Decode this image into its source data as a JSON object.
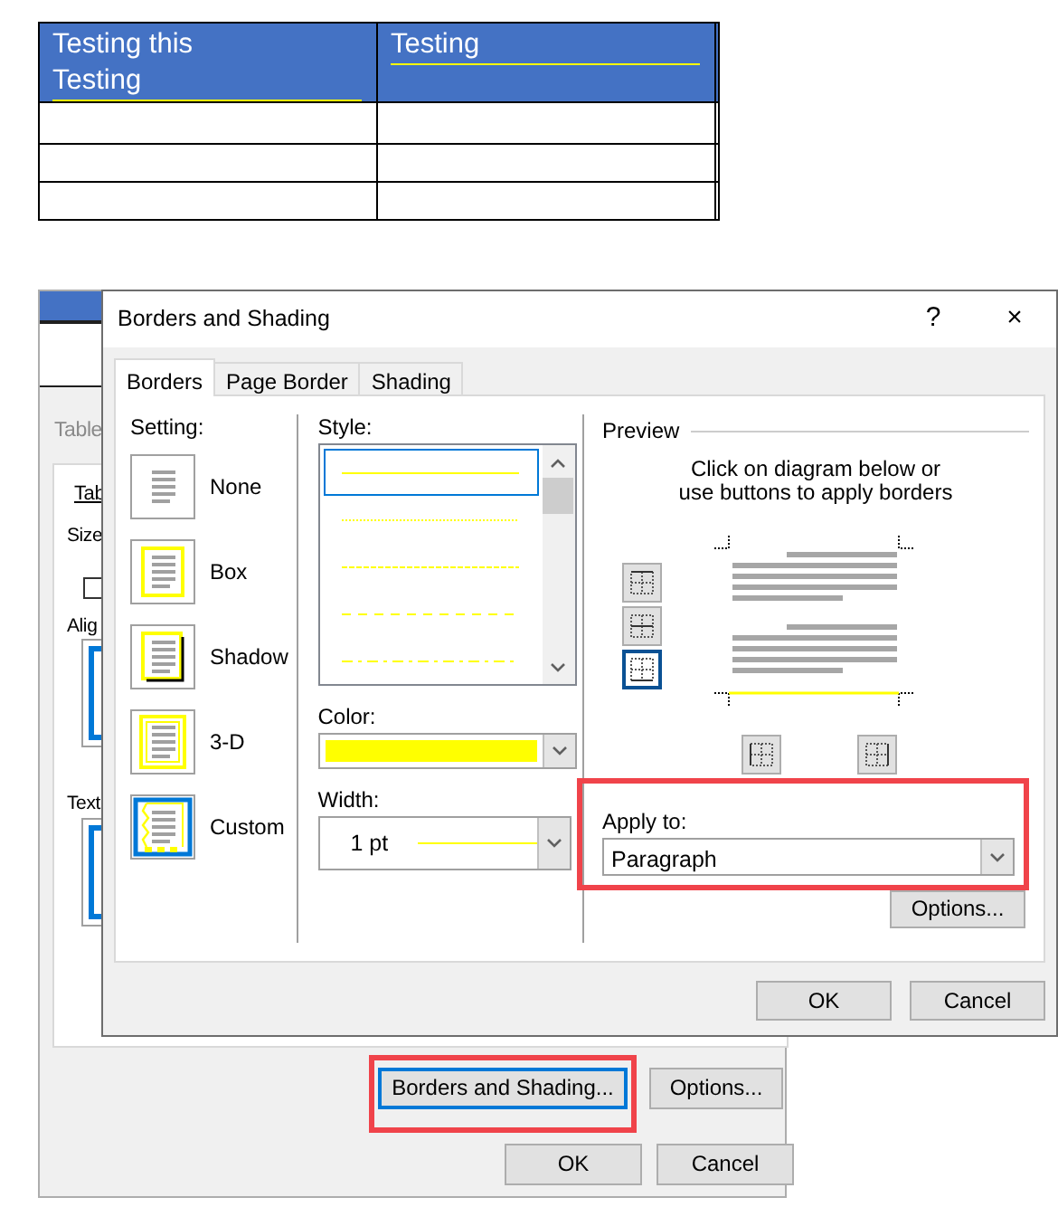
{
  "document_table": {
    "header_cells": [
      {
        "lines": [
          "Testing this",
          "Testing"
        ],
        "bottom_border": true
      },
      {
        "lines": [
          "Testing"
        ],
        "bottom_border": true
      }
    ]
  },
  "table_properties": {
    "caption": "Table",
    "tab": "Tab",
    "labels": [
      "Size",
      "Alig",
      "Text"
    ],
    "checkbox": {
      "checked": false
    },
    "buttons": [
      {
        "label": "Borders and Shading...",
        "focused": true,
        "highlighted": true
      },
      {
        "label": "Options...",
        "focused": false,
        "highlighted": false
      }
    ],
    "footer_buttons": [
      "OK",
      "Cancel"
    ]
  },
  "dialog": {
    "title": "Borders and Shading",
    "help": "?",
    "close": "×",
    "tabs": [
      {
        "label": "Borders",
        "selected": true
      },
      {
        "label": "Page Border",
        "selected": false
      },
      {
        "label": "Shading",
        "selected": false
      }
    ],
    "setting": {
      "label": "Setting:",
      "options": [
        {
          "kind": "none",
          "label": "None",
          "selected": false
        },
        {
          "kind": "box",
          "label": "Box",
          "selected": false
        },
        {
          "kind": "shadow",
          "label": "Shadow",
          "selected": false
        },
        {
          "kind": "threed",
          "label": "3-D",
          "selected": false
        },
        {
          "kind": "custom",
          "label": "Custom",
          "selected": true
        }
      ]
    },
    "style": {
      "label": "Style:",
      "lines": [
        {
          "kind": "solid",
          "selected": true
        },
        {
          "kind": "dotted",
          "selected": false
        },
        {
          "kind": "dashed",
          "selected": false
        },
        {
          "kind": "long-dash",
          "selected": false
        },
        {
          "kind": "dash-dot",
          "selected": false
        }
      ]
    },
    "color": {
      "label": "Color:",
      "swatch": {
        "color": "#ffff00"
      }
    },
    "width": {
      "label": "Width:",
      "value": "1 pt"
    },
    "preview": {
      "label": "Preview",
      "hint_lines": [
        "Click on diagram below or",
        "use buttons to apply borders"
      ],
      "side_buttons": [
        {
          "kind": "top",
          "on": false
        },
        {
          "kind": "middle",
          "on": false
        },
        {
          "kind": "bottom",
          "on": true
        }
      ],
      "bottom_buttons": [
        {
          "kind": "left",
          "on": false
        },
        {
          "kind": "right",
          "on": false
        }
      ]
    },
    "apply_to": {
      "label": "Apply to:",
      "value": "Paragraph",
      "highlighted": true
    },
    "options_button": "Options...",
    "buttons": [
      "OK",
      "Cancel"
    ]
  }
}
